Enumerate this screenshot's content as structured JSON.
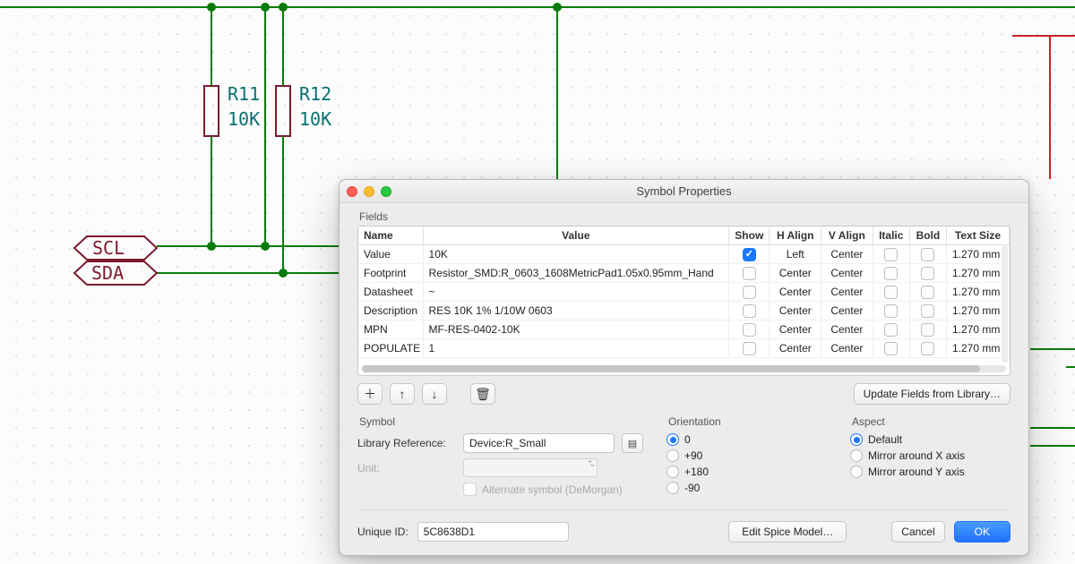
{
  "schematic": {
    "r11": {
      "ref": "R11",
      "val": "10K"
    },
    "r12": {
      "ref": "R12",
      "val": "10K"
    },
    "labels": {
      "scl": "SCL",
      "sda": "SDA"
    }
  },
  "dialog": {
    "title": "Symbol Properties",
    "fields_label": "Fields",
    "headers": {
      "name": "Name",
      "value": "Value",
      "show": "Show",
      "halign": "H Align",
      "valign": "V Align",
      "italic": "Italic",
      "bold": "Bold",
      "textsize": "Text Size"
    },
    "rows": [
      {
        "name": "Value",
        "value": "10K",
        "show": true,
        "ha": "Left",
        "va": "Center",
        "ts": "1.270 mm"
      },
      {
        "name": "Footprint",
        "value": "Resistor_SMD:R_0603_1608MetricPad1.05x0.95mm_Hand",
        "show": false,
        "ha": "Center",
        "va": "Center",
        "ts": "1.270 mm"
      },
      {
        "name": "Datasheet",
        "value": "~",
        "show": false,
        "ha": "Center",
        "va": "Center",
        "ts": "1.270 mm"
      },
      {
        "name": "Description",
        "value": "RES 10K 1% 1/10W 0603",
        "show": false,
        "ha": "Center",
        "va": "Center",
        "ts": "1.270 mm"
      },
      {
        "name": "MPN",
        "value": "MF-RES-0402-10K",
        "show": false,
        "ha": "Center",
        "va": "Center",
        "ts": "1.270 mm"
      },
      {
        "name": "POPULATE",
        "value": "1",
        "show": false,
        "ha": "Center",
        "va": "Center",
        "ts": "1.270 mm"
      }
    ],
    "buttons": {
      "update": "Update Fields from Library…",
      "edit_spice": "Edit Spice Model…",
      "cancel": "Cancel",
      "ok": "OK"
    },
    "symbol": {
      "label": "Symbol",
      "libref_label": "Library Reference:",
      "libref_value": "Device:R_Small",
      "unit_label": "Unit:",
      "alt_label": "Alternate symbol (DeMorgan)"
    },
    "orientation": {
      "label": "Orientation",
      "o0": "0",
      "o90": "+90",
      "o180": "+180",
      "om90": "-90"
    },
    "aspect": {
      "label": "Aspect",
      "def": "Default",
      "mx": "Mirror around X axis",
      "my": "Mirror around Y axis"
    },
    "unique_id_label": "Unique ID:",
    "unique_id_value": "5C8638D1"
  }
}
